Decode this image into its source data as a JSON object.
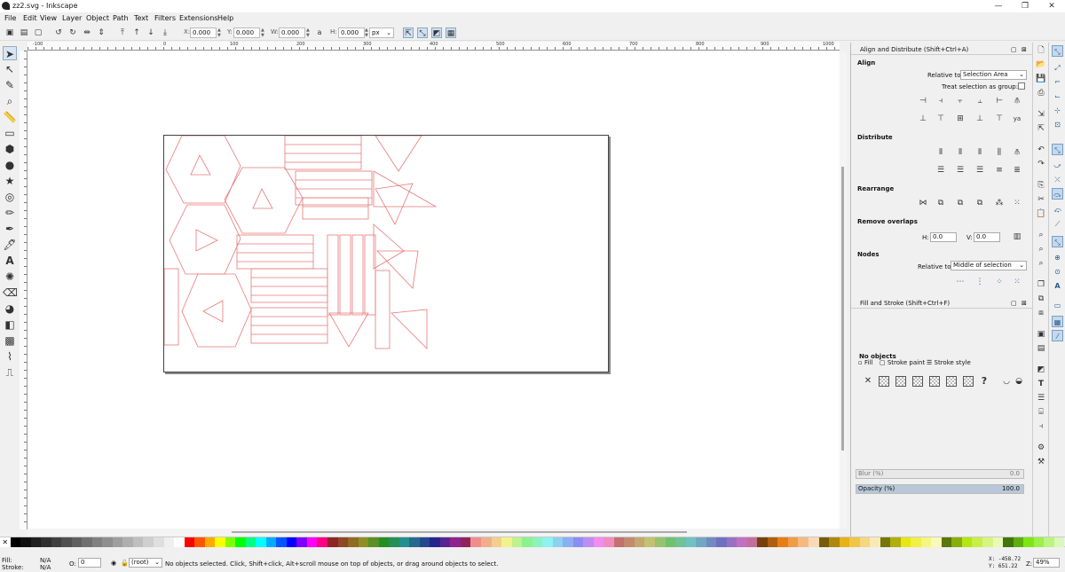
{
  "window": {
    "title": "zz2.svg - Inkscape",
    "minimize": "—",
    "maximize": "❐",
    "close": "✕"
  },
  "menu": [
    "File",
    "Edit",
    "View",
    "Layer",
    "Object",
    "Path",
    "Text",
    "Filters",
    "Extensions",
    "Help"
  ],
  "toolbar": {
    "x_label": "X:",
    "x_value": "0.000",
    "y_label": "Y:",
    "y_value": "0.000",
    "w_label": "W:",
    "w_value": "0.000",
    "h_label": "H:",
    "h_value": "0.000",
    "unit": "px"
  },
  "ruler": {
    "ticks": [
      "-100",
      "0",
      "100",
      "200",
      "300",
      "400",
      "500",
      "600",
      "700",
      "800",
      "900",
      "1000"
    ]
  },
  "align_panel": {
    "title": "Align and Distribute (Shift+Ctrl+A)",
    "align_heading": "Align",
    "relative_to_label": "Relative to:",
    "relative_to_value": "Selection Area",
    "treat_as_group": "Treat selection as group:",
    "distribute_heading": "Distribute",
    "rearrange_heading": "Rearrange",
    "remove_overlaps_heading": "Remove overlaps",
    "h_label": "H:",
    "h_value": "0.0",
    "v_label": "V:",
    "v_value": "0.0",
    "nodes_heading": "Nodes",
    "nodes_relative_label": "Relative to:",
    "nodes_relative_value": "Middle of selection"
  },
  "fill_panel": {
    "title": "Fill and Stroke (Shift+Ctrl+F)",
    "tab_fill": "Fill",
    "tab_stroke_paint": "Stroke paint",
    "tab_stroke_style": "Stroke style",
    "no_objects": "No objects",
    "blur_label": "Blur (%)",
    "blur_value": "0.0",
    "opacity_label": "Opacity (%)",
    "opacity_value": "100.0"
  },
  "status": {
    "fill_label": "Fill:",
    "fill_value": "N/A",
    "stroke_label": "Stroke:",
    "stroke_value": "N/A",
    "o_label": "O:",
    "o_value": "0",
    "layer": "(root)",
    "message": "No objects selected. Click, Shift+click, Alt+scroll mouse on top of objects, or drag around objects to select.",
    "x_coord": "X: -458.72",
    "y_coord": "Y: 651.22",
    "zoom_label": "Z:",
    "zoom_value": "49%"
  },
  "colors": {
    "accent": "#cfe0f5",
    "shape_stroke": "#e87878",
    "page_border": "#444444"
  }
}
